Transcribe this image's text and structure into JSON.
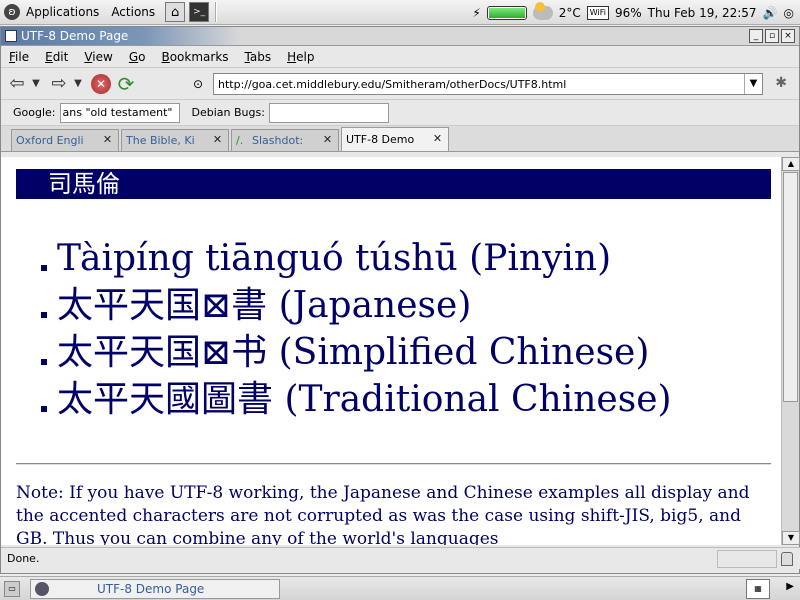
{
  "top_panel": {
    "menus": [
      "Applications",
      "Actions"
    ],
    "temperature": "2°C",
    "wifi_label": "WiFi",
    "battery_percent": 96,
    "battery_label": "96%",
    "clock": "Thu Feb 19, 22:57"
  },
  "window": {
    "title": "UTF-8 Demo Page",
    "controls": [
      "_",
      "▫",
      "×"
    ]
  },
  "menubar": {
    "items": [
      {
        "label": "File",
        "key": "F"
      },
      {
        "label": "Edit",
        "key": "E"
      },
      {
        "label": "View",
        "key": "V"
      },
      {
        "label": "Go",
        "key": "G"
      },
      {
        "label": "Bookmarks",
        "key": "B"
      },
      {
        "label": "Tabs",
        "key": "T"
      },
      {
        "label": "Help",
        "key": "H"
      }
    ]
  },
  "navbar": {
    "url": "http://goa.cet.middlebury.edu/Smitheram/otherDocs/UTF8.html"
  },
  "searchbar": {
    "google_label": "Google:",
    "google_value": "ans \"old testament\"",
    "debian_label": "Debian Bugs:",
    "debian_value": ""
  },
  "tabs": [
    {
      "label": "Oxford Engli",
      "active": false
    },
    {
      "label": "The Bible, Ki",
      "active": false
    },
    {
      "label": "Slashdot:",
      "active": false
    },
    {
      "label": "UTF-8 Demo",
      "active": true
    }
  ],
  "content": {
    "name_banner": "司馬倫",
    "titles": [
      "Tàipíng tiānguó túshū (Pinyin)",
      "太平天国⊠書 (Japanese)",
      "太平天国⊠书 (Simplified Chinese)",
      "太平天國圖書 (Traditional Chinese)"
    ],
    "note": "Note: If you have UTF-8 working, the Japanese and Chinese examples all display and the accented characters are not corrupted as was the case using shift-JIS, big5, and GB. Thus you can combine any of the world's languages"
  },
  "status": {
    "text": "Done."
  },
  "bottom_panel": {
    "task_label": "UTF-8 Demo Page"
  }
}
